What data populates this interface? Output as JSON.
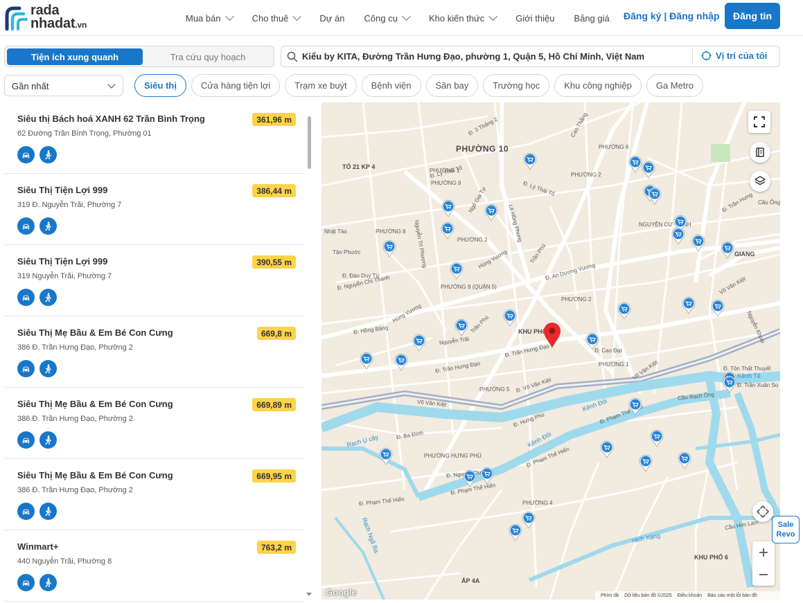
{
  "header": {
    "logo_line1": "rada",
    "logo_line2": "nhadat",
    "logo_suffix": ".vn",
    "nav": [
      {
        "label": "Mua bán",
        "dropdown": true
      },
      {
        "label": "Cho thuê",
        "dropdown": true
      },
      {
        "label": "Dự án",
        "dropdown": false
      },
      {
        "label": "Công cụ",
        "dropdown": true
      },
      {
        "label": "Kho kiến thức",
        "dropdown": true
      },
      {
        "label": "Giới thiệu",
        "dropdown": false
      },
      {
        "label": "Bảng giá",
        "dropdown": false
      }
    ],
    "register": "Đăng ký",
    "separator": " | ",
    "login": "Đăng nhập",
    "post_button": "Đăng tin"
  },
  "toolbar": {
    "tab_active": "Tiện ích xung quanh",
    "tab_inactive": "Tra cứu quy hoạch",
    "search_value": "Kiểu by KITA, Đường Trần Hưng Đạo, phường 1, Quận 5, Hồ Chí Minh, Việt Nam",
    "locate_label": "Vị trí của tôi",
    "sort_value": "Gần nhất",
    "categories": [
      {
        "label": "Siêu thị",
        "active": true
      },
      {
        "label": "Cửa hàng tiện lợi",
        "active": false
      },
      {
        "label": "Trạm xe buýt",
        "active": false
      },
      {
        "label": "Bệnh viện",
        "active": false
      },
      {
        "label": "Sân bay",
        "active": false
      },
      {
        "label": "Trường học",
        "active": false
      },
      {
        "label": "Khu công nghiệp",
        "active": false
      },
      {
        "label": "Ga Metro",
        "active": false
      }
    ]
  },
  "results": [
    {
      "name": "Siêu thị Bách hoá XANH 62 Trần Bình Trọng",
      "address": "62 Đường Trần Bình Trọng, Phường 01",
      "distance": "361,96 m"
    },
    {
      "name": "Siêu Thị Tiện Lợi 999",
      "address": "319 Đ. Nguyễn Trãi, Phường 7",
      "distance": "386,44 m"
    },
    {
      "name": "Siêu Thị Tiện Lợi 999",
      "address": "319 Nguyễn Trãi, Phường 7",
      "distance": "390,55 m"
    },
    {
      "name": "Siêu Thị Mẹ Bầu & Em Bé Con Cưng",
      "address": "386 Đ. Trần Hưng Đạo, Phường 2",
      "distance": "669,8 m"
    },
    {
      "name": "Siêu Thị Mẹ Bầu & Em Bé Con Cưng",
      "address": "386 Đ. Trần Hưng Đạo, Phường 2",
      "distance": "669,89 m"
    },
    {
      "name": "Siêu Thị Mẹ Bầu & Em Bé Con Cưng",
      "address": "386 Đ. Trần Hưng Đạo, Phường 2",
      "distance": "669,95 m"
    },
    {
      "name": "Winmart+",
      "address": "440 Nguyễn Trãi, Phường 8",
      "distance": "763,2 m"
    }
  ],
  "map": {
    "labels": {
      "phuong10": "PHƯỜNG 10",
      "to21": "TỔ 21 KP 4",
      "phuong9": "PHƯỜNG 9",
      "phuong9q5": "PHƯỜNG 9 (QUẬN 5)",
      "phuong8": "PHƯỜNG 8",
      "phuong2a": "PHƯỜNG 2",
      "phuong2b": "PHƯỜNG 2",
      "phuong2c": "PHƯỜNG 2",
      "phuong1a": "PHƯỜNG 1",
      "phuong1b": "PHƯỜNG 1",
      "phuong5": "PHƯỜNG 5",
      "phuong4": "PHƯỜNG 4",
      "phuong6": "PHƯỜNG 6",
      "phuonghungphu": "PHƯỜNG HƯNG PHÚ",
      "khupho": "KHU PHỐ",
      "khupho6": "KHU PHỐ 6",
      "nguyencutrinh": "NGUYỄN CƯ TRINH",
      "ap4a": "ẤP 4A",
      "road_tranhungdao": "Đ. Trần Hưng Đạo",
      "road_tranhungdao2": "Đ. Trần Hưng Đạo",
      "road_vovankiet": "Võ Văn Kiệt",
      "road_vovankiet2": "Đ. Võ Văn Kiệt",
      "road_vovankiet3": "Võ Văn Kiệt",
      "road_vovankiet4": "Võ Văn Kiệt",
      "road_anduongvuong": "Đ. An Dương Vương",
      "road_hungvuong": "Hùng Vương",
      "road_hungvuong2": "Hùng Vương",
      "road_nguyentrai": "Nguyễn Trãi",
      "road_tranphu": "Trần Phú",
      "road_tranphu2": "Trần Phú",
      "road_lythaito": "Đ. Lý Thái Tổ",
      "road_lythaito2": "Đ. Lý Thái Tổ",
      "road_3thang2": "Đ. 3 Tháng 2",
      "road_nguyentriphuong": "Nguyễn Tri Phương",
      "road_lehongphong": "Lê Hồng Phong",
      "road_nguyenchithanh": "Đ. Nguyễn Chí Thanh",
      "road_honbang": "Đ. Hồng Bàng",
      "road_ngogiatu": "Ngô Gia Tự",
      "road_caodat": "Đ. Cao Đạt",
      "road_hungphu": "Đ. Hưng Phú",
      "road_phamthehien": "Đ. Phạm Thế Hiển",
      "road_phamthehien2": "Đ. Phạm Thế Hiển",
      "road_phamthehien3": "Đ. Phạm Thế Hiển",
      "road_phamthehien4": "Đ. Phạm Thế Hiển",
      "road_nguyenduy": "Đ. Nguyễn Duy",
      "road_tonthatthuyet": "Đ. Tôn Thất Thuyết",
      "road_tranxuanso": "Đ. Trần Xuân So",
      "road_caurachong": "Cầu Rạch Ông",
      "road_kenhdoi": "Kênh Đôi",
      "road_kenhdoi2": "Kênh Đôi",
      "road_kenhte": "Kênh Tẻ",
      "road_rachuyay": "Rạch Ụ cây",
      "road_rachxang": "rạch Xáng",
      "road_cauhimlam": "Cầu Him Lam",
      "road_nguyenkhoai": "Nguyễn Khoái",
      "road_tranhung": "Đ. Trần Hưng",
      "road_baudinh": "Đ. Ba Đình",
      "road_nhattao": "Nhật Tảo",
      "road_tanphuoc": "Tân Phước",
      "road_daoduytu": "Đ. Đào Duy Từ",
      "road_caothang": "Cao Thắng",
      "road_caulong": "Cầu Ông",
      "road_giang": "GIANG",
      "road_rachngaba": "Rạch Ngã Ba"
    },
    "google": "Google",
    "attribution": [
      "Phím tắt",
      "Dữ liệu bản đồ ©2025",
      "Điều khoản",
      "Báo cáo một lỗi bản đồ"
    ]
  },
  "sale_badge": {
    "line1": "Sale",
    "line2": "Revo"
  },
  "colors": {
    "primary": "#1877c8",
    "distance_badge": "#fdd34a",
    "pin": "#e8282b",
    "water": "#9fd9ec"
  }
}
